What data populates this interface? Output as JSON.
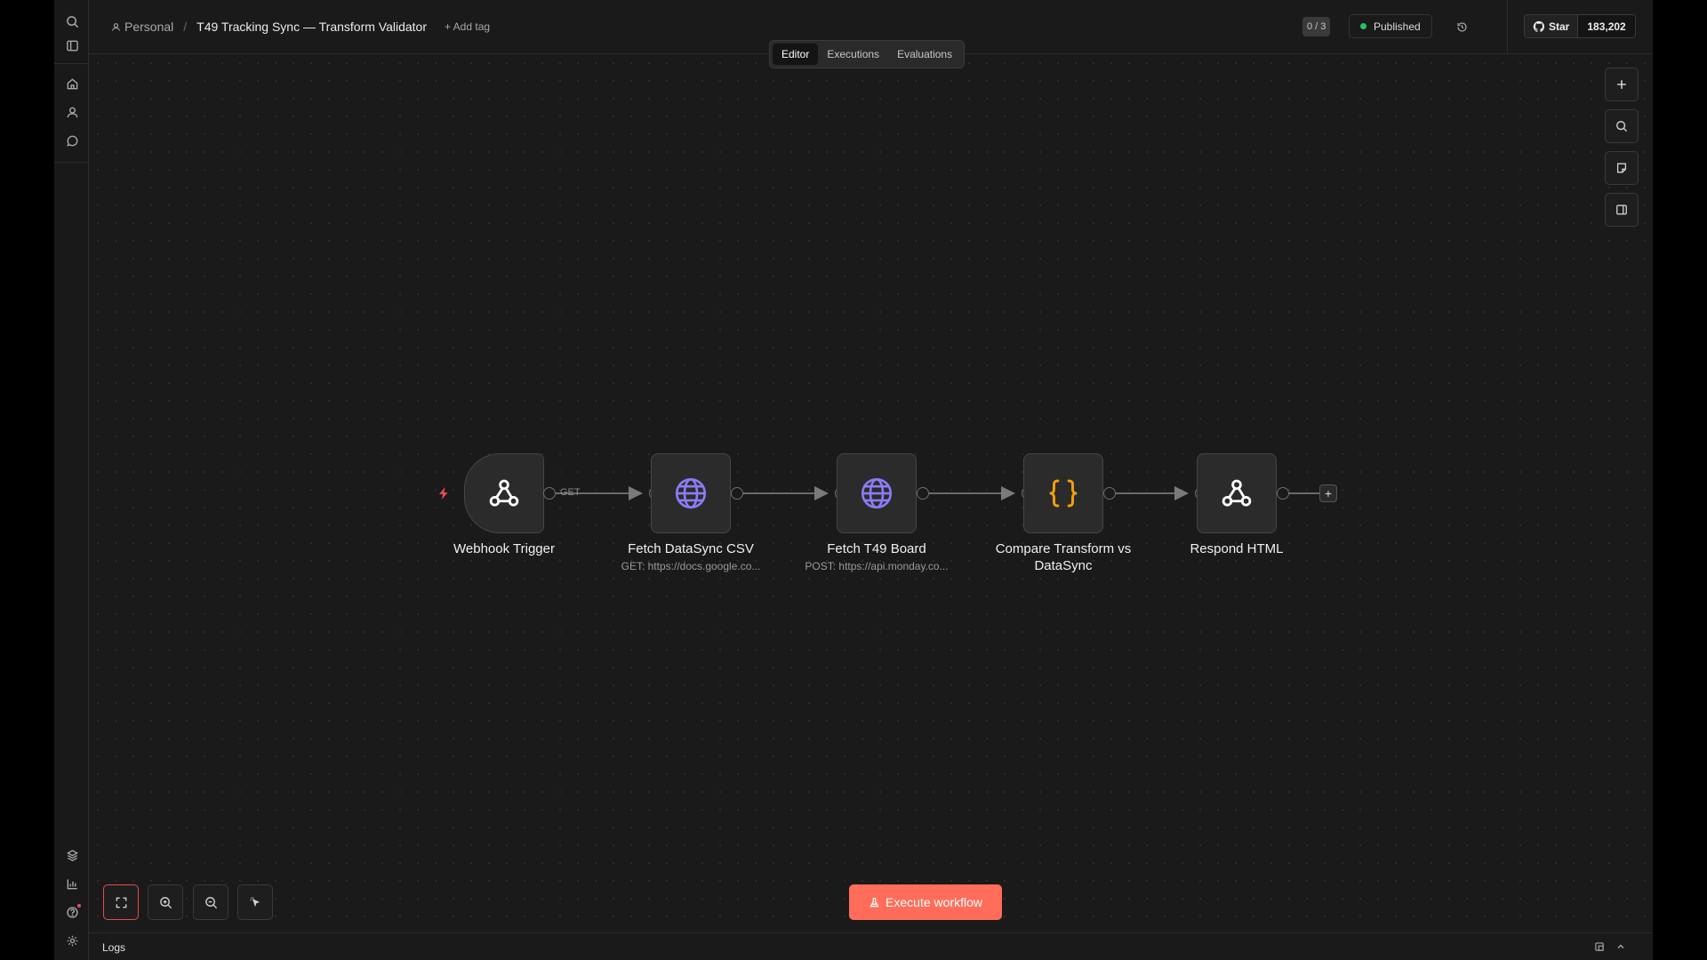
{
  "header": {
    "breadcrumb_personal": "Personal",
    "breadcrumb_separator": "/",
    "workflow_title": "T49 Tracking Sync — Transform Validator",
    "add_tag": "+ Add tag",
    "counter": "0 / 3",
    "status": "Published",
    "github_star_label": "Star",
    "github_star_count": "183,202"
  },
  "tabs": [
    {
      "label": "Editor",
      "active": true
    },
    {
      "label": "Executions",
      "active": false
    },
    {
      "label": "Evaluations",
      "active": false
    }
  ],
  "nodes": [
    {
      "label": "Webhook Trigger",
      "subtitle": "",
      "icon": "webhook-icon"
    },
    {
      "label": "Fetch DataSync CSV",
      "subtitle": "GET: https://docs.google.co...",
      "icon": "globe-icon"
    },
    {
      "label": "Fetch T49 Board",
      "subtitle": "POST: https://api.monday.co...",
      "icon": "globe-icon"
    },
    {
      "label": "Compare Transform vs DataSync",
      "subtitle": "",
      "icon": "code-braces-icon"
    },
    {
      "label": "Respond HTML",
      "subtitle": "",
      "icon": "webhook-icon"
    }
  ],
  "edge_label": "GET",
  "add_node_symbol": "+",
  "execute_button": "Execute workflow",
  "logs_label": "Logs",
  "colors": {
    "accent": "#ff6d5a",
    "published_dot": "#22c55e",
    "http_icon": "#8b7cf6",
    "code_icon": "#f59e0b",
    "trigger_bolt": "#ea4b4b"
  }
}
